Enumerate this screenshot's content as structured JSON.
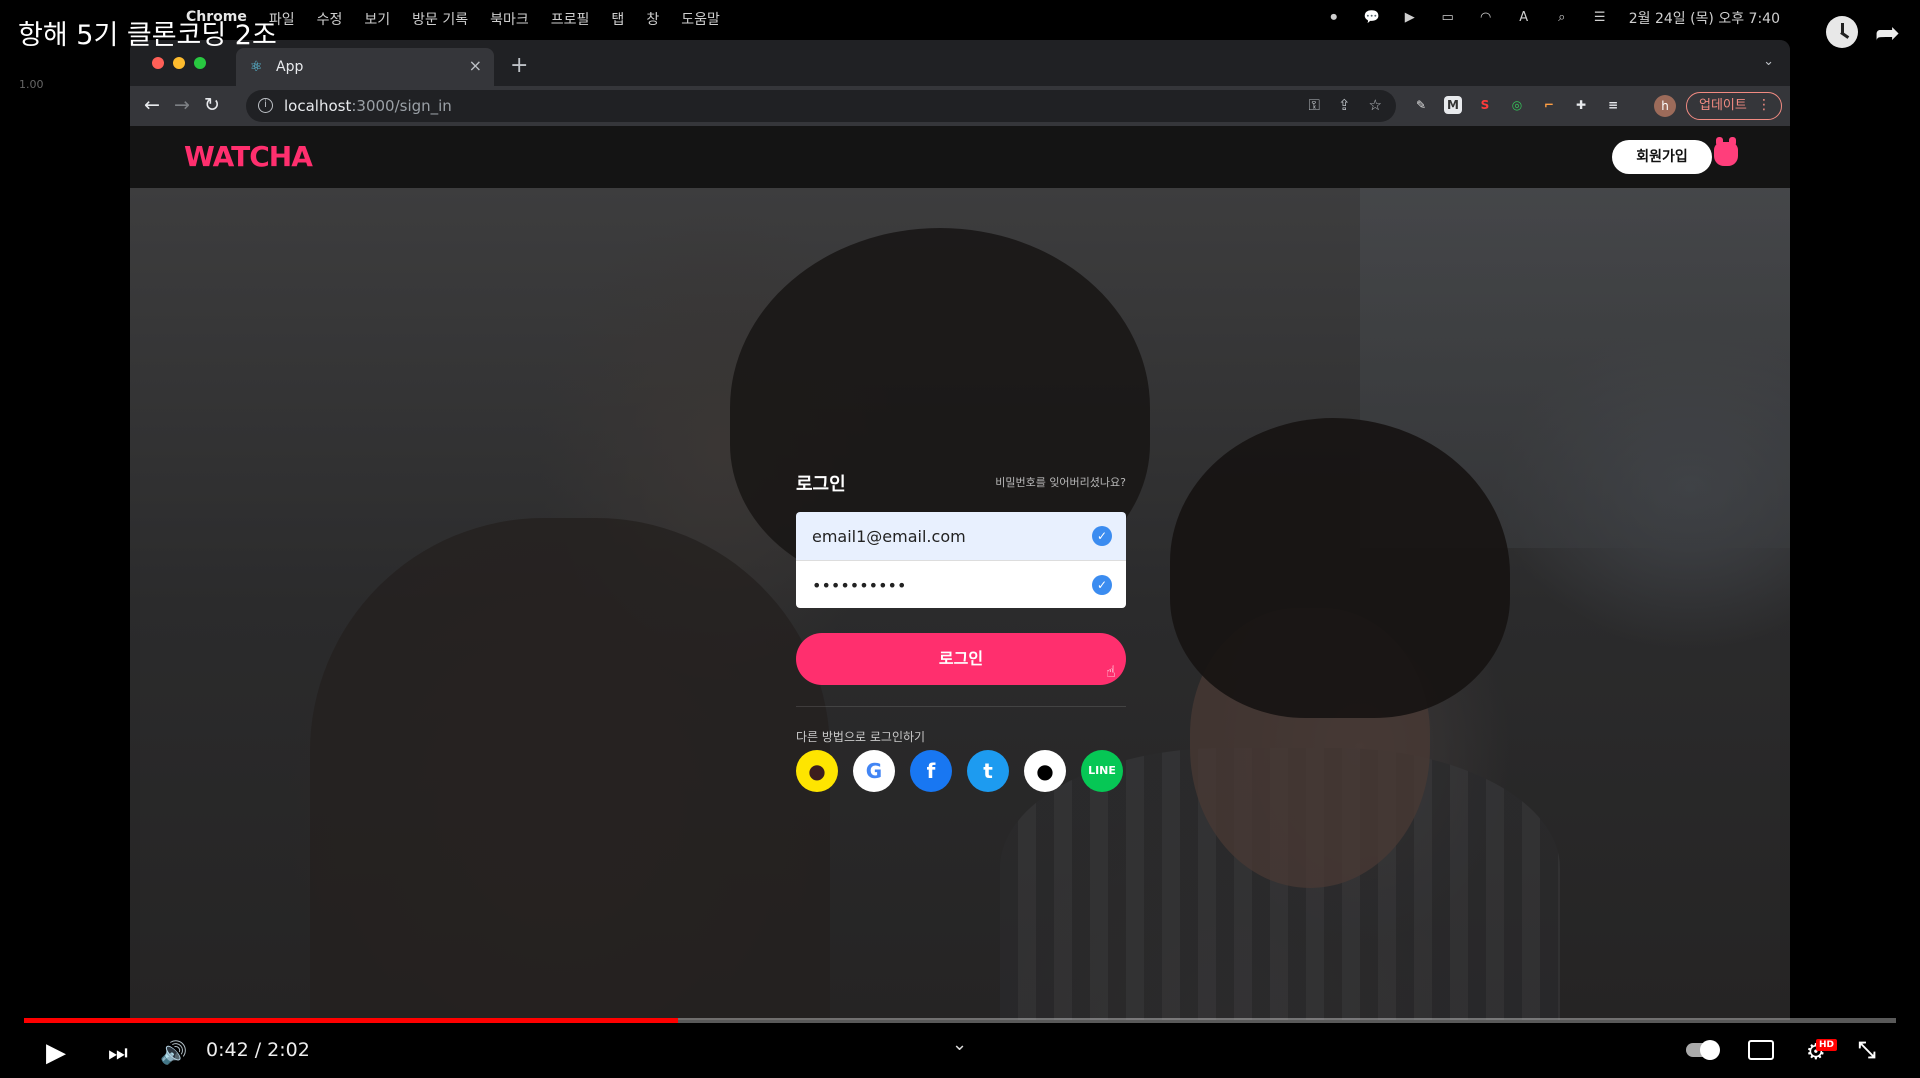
{
  "video_title": "항해 5기 클론코딩 2조",
  "speed_label": "1.00",
  "mac_menubar": {
    "apple": "",
    "items": [
      "Chrome",
      "파일",
      "수정",
      "보기",
      "방문 기록",
      "북마크",
      "프로필",
      "탭",
      "창",
      "도움말"
    ],
    "datetime": "2월 24일 (목) 오후 7:40"
  },
  "browser": {
    "tab_title": "App",
    "tab_close": "×",
    "new_tab": "+",
    "url_host": "localhost",
    "url_rest": ":3000/sign_in",
    "update_label": "업데이트",
    "profile_initial": "h"
  },
  "site": {
    "logo": "WATCHA",
    "signup_label": "회원가입",
    "login": {
      "title": "로그인",
      "forgot_label": "비밀번호를 잊어버리셨나요?",
      "email_value": "email1@email.com",
      "password_value": "••••••••••",
      "submit_label": "로그인",
      "other_methods_label": "다른 방법으로 로그인하기",
      "socials": [
        "kakao",
        "google",
        "facebook",
        "twitter",
        "apple",
        "line"
      ]
    }
  },
  "player": {
    "current_time": "0:42",
    "duration": "2:02",
    "time_display": "0:42 / 2:02",
    "progress_fraction": 0.3496,
    "hd_badge": "HD"
  },
  "colors": {
    "brand": "#ff2f6e",
    "check": "#3b8cf0",
    "progress": "#ff0000"
  }
}
